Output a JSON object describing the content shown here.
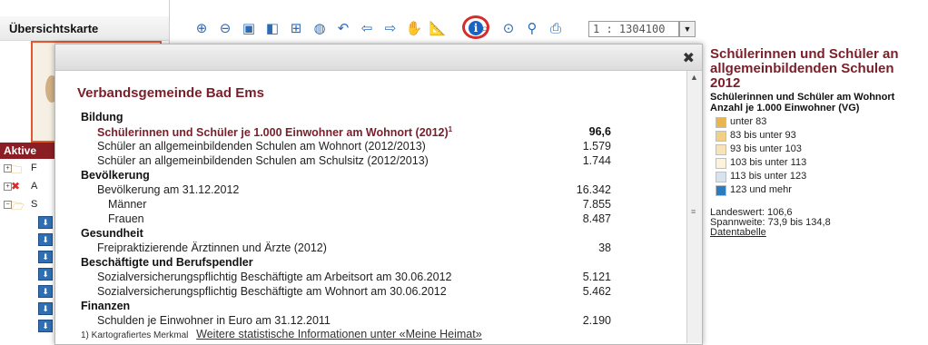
{
  "overview": {
    "title": "Übersichtskarte"
  },
  "active_panel": {
    "header": "Aktive",
    "tree": [
      {
        "letter": "F",
        "icon": "folder-icon"
      },
      {
        "letter": "A",
        "icon": "error-x-icon"
      },
      {
        "letter": "S",
        "icon": "folder-open-icon"
      }
    ],
    "layer_buttons": 7
  },
  "toolbar": {
    "tools": [
      "zoom-in-icon",
      "zoom-out-icon",
      "zoom-extent-icon",
      "zoom-layer-icon",
      "zoom-grid-icon",
      "globe-icon",
      "undo-icon",
      "arrow-left-icon",
      "arrow-right-icon",
      "pan-icon",
      "measure-icon",
      "info-icon",
      "search-icon",
      "search-region-icon",
      "pin-icon",
      "print-icon"
    ],
    "info_label": "i",
    "scale": "1 : 1304100"
  },
  "popup": {
    "title": "Verbandsgemeinde Bad Ems",
    "rows": [
      {
        "kind": "section",
        "name": "Bildung",
        "value": ""
      },
      {
        "kind": "l1 hl",
        "name": "Schülerinnen und Schüler je 1.000 Einwohner am Wohnort (2012)",
        "sup": "1",
        "value": "96,6"
      },
      {
        "kind": "l1",
        "name": "Schüler an allgemeinbildenden Schulen am Wohnort (2012/2013)",
        "value": "1.579"
      },
      {
        "kind": "l1",
        "name": "Schüler an allgemeinbildenden Schulen am Schulsitz (2012/2013)",
        "value": "1.744"
      },
      {
        "kind": "section",
        "name": "Bevölkerung",
        "value": ""
      },
      {
        "kind": "l1",
        "name": "Bevölkerung am 31.12.2012",
        "value": "16.342"
      },
      {
        "kind": "l2",
        "name": "Männer",
        "value": "7.855"
      },
      {
        "kind": "l2",
        "name": "Frauen",
        "value": "8.487"
      },
      {
        "kind": "section",
        "name": "Gesundheit",
        "value": ""
      },
      {
        "kind": "l1",
        "name": "Freipraktizierende Ärztinnen und Ärzte (2012)",
        "value": "38"
      },
      {
        "kind": "section",
        "name": "Beschäftigte und Berufspendler",
        "value": ""
      },
      {
        "kind": "l1",
        "name": "Sozialversicherungspflichtig Beschäftigte am Arbeitsort am 30.06.2012",
        "value": "5.121"
      },
      {
        "kind": "l1",
        "name": "Sozialversicherungspflichtig Beschäftigte am Wohnort am 30.06.2012",
        "value": "5.462"
      },
      {
        "kind": "section",
        "name": "Finanzen",
        "value": ""
      },
      {
        "kind": "l1",
        "name": "Schulden je Einwohner in Euro am 31.12.2011",
        "value": "2.190"
      }
    ],
    "footnote": "1) Kartografiertes Merkmal",
    "more_link": "Weitere statistische Informationen unter «Meine Heimat»"
  },
  "legend": {
    "title": "Schülerinnen und Schüler an allgemeinbildenden Schulen 2012",
    "subtitle": "Schülerinnen und Schüler am Wohnort Anzahl je 1.000 Einwohner (VG)",
    "items": [
      {
        "label": "unter 83",
        "color": "#e8b64c"
      },
      {
        "label": "83 bis unter 93",
        "color": "#f2d083"
      },
      {
        "label": "93 bis unter 103",
        "color": "#f7e3b5"
      },
      {
        "label": "103 bis unter 113",
        "color": "#fbf3dc"
      },
      {
        "label": "113 bis unter 123",
        "color": "#d7e4f0"
      },
      {
        "label": "123 und mehr",
        "color": "#2c7bbf"
      }
    ],
    "landeswert": "Landeswert: 106,6",
    "spannweite": "Spannweite: 73,9 bis 134,8",
    "data_link": "Datentabelle"
  }
}
